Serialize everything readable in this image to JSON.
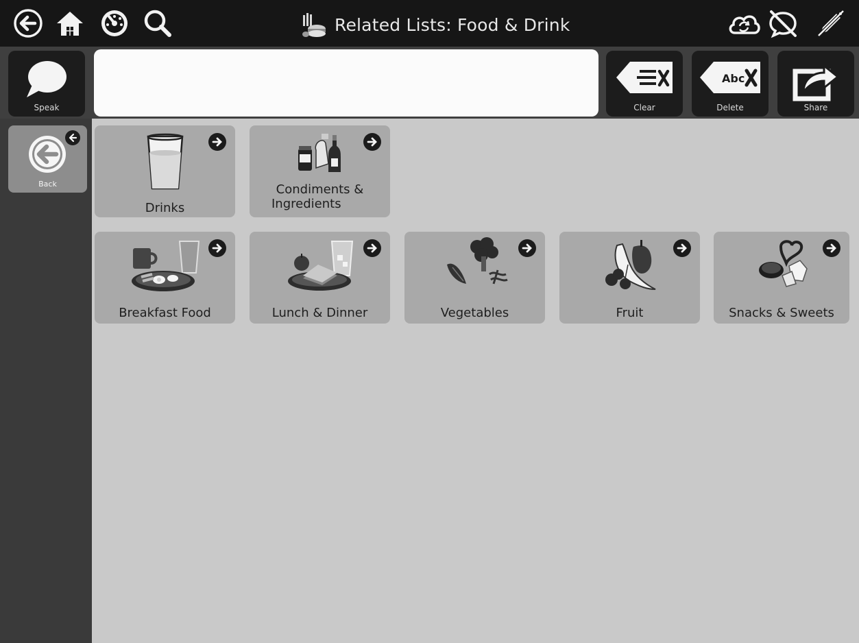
{
  "topbar": {
    "title": "Related Lists: Food & Drink",
    "left_icons": [
      "back-arrow-icon",
      "home-icon",
      "speedometer-icon",
      "search-icon"
    ],
    "right_icons": [
      "cloud-sync-icon",
      "chat-off-icon",
      "edit-off-icon"
    ]
  },
  "toolbar": {
    "speak_label": "Speak",
    "clear_label": "Clear",
    "delete_label": "Delete",
    "share_label": "Share",
    "delete_key_text": "Abc"
  },
  "message": {
    "text": ""
  },
  "sidebar": {
    "back_label": "Back"
  },
  "tiles": [
    {
      "label": "Drinks",
      "icon": "glass-of-water-icon"
    },
    {
      "label": "Condiments &",
      "label2": "Ingredients",
      "icon": "condiment-bottles-icon"
    },
    {
      "label": "Breakfast Food",
      "icon": "breakfast-plate-icon"
    },
    {
      "label": "Lunch & Dinner",
      "icon": "sandwich-plate-icon"
    },
    {
      "label": "Vegetables",
      "icon": "vegetables-icon"
    },
    {
      "label": "Fruit",
      "icon": "fruit-icon"
    },
    {
      "label": "Snacks & Sweets",
      "icon": "snacks-icon"
    }
  ],
  "colors": {
    "topbar": "#161616",
    "message_row": "#3f3f3f",
    "sidebar": "#3a3a3a",
    "content_bg": "#c9c9c9",
    "tile_bg": "#a9a9a9"
  }
}
